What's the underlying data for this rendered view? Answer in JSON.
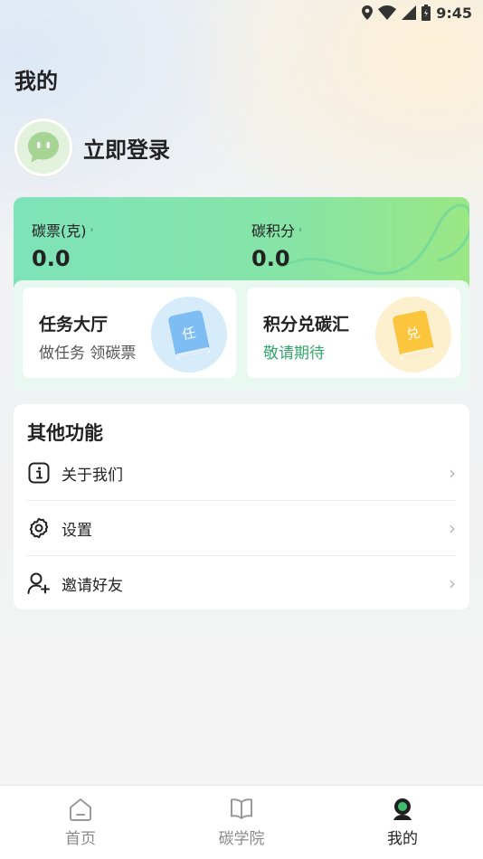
{
  "status_bar": {
    "time": "9:45"
  },
  "page": {
    "title": "我的"
  },
  "user": {
    "login_text": "立即登录"
  },
  "carbon": {
    "stats": [
      {
        "label": "碳票(克)",
        "value": "0.0"
      },
      {
        "label": "碳积分",
        "value": "0.0"
      }
    ],
    "cards": [
      {
        "title": "任务大厅",
        "desc": "做任务 领碳票",
        "icon_char": "任"
      },
      {
        "title": "积分兑碳汇",
        "desc": "敬请期待",
        "icon_char": "兑"
      }
    ]
  },
  "functions": {
    "title": "其他功能",
    "items": [
      {
        "label": "关于我们",
        "icon": "info-icon"
      },
      {
        "label": "设置",
        "icon": "gear-icon"
      },
      {
        "label": "邀请好友",
        "icon": "add-user-icon"
      }
    ]
  },
  "tabs": [
    {
      "label": "首页",
      "icon": "home-icon"
    },
    {
      "label": "碳学院",
      "icon": "book-icon"
    },
    {
      "label": "我的",
      "icon": "profile-icon",
      "active": true
    }
  ],
  "colors": {
    "accent_green": "#33a86b",
    "card_gradient_start": "#7ee3ba",
    "card_gradient_end": "#9be785"
  }
}
